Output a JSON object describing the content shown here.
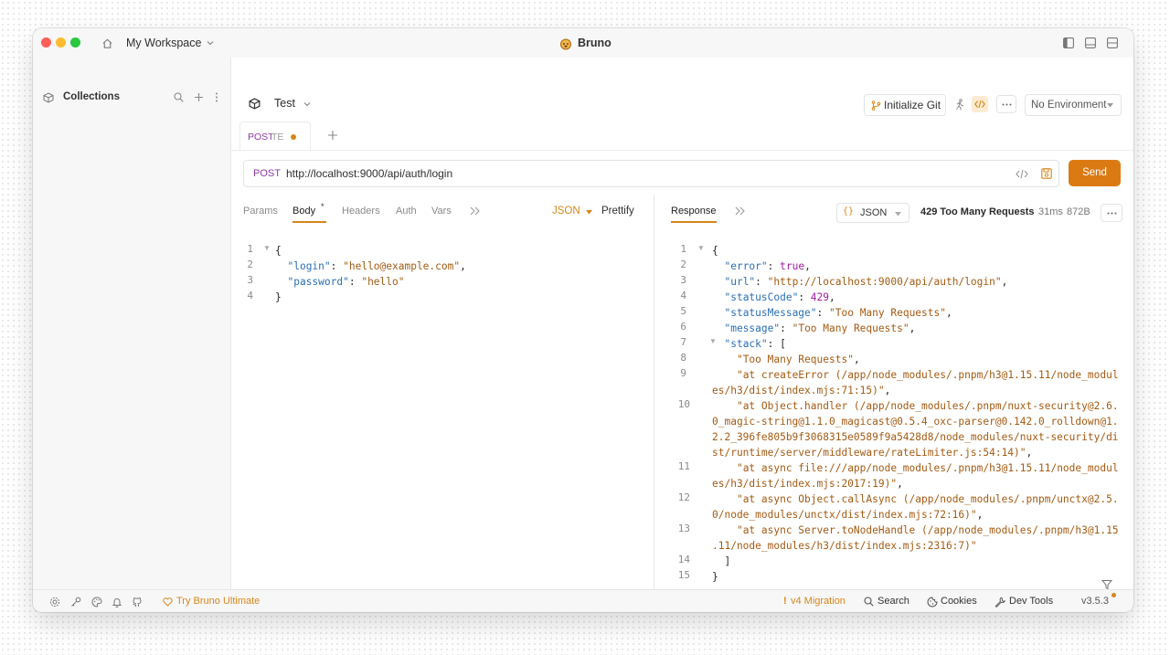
{
  "titlebar": {
    "workspace": "My Workspace",
    "app_title": "Bruno"
  },
  "sidebar": {
    "title": "Collections"
  },
  "collection": {
    "name": "Test",
    "init_git": "Initialize Git",
    "environment": "No Environment"
  },
  "tab": {
    "method": "POST",
    "name": "TE"
  },
  "request": {
    "method": "POST",
    "url": "http://localhost:9000/api/auth/login",
    "send_label": "Send",
    "tabs": [
      "Params",
      "Body",
      "Headers",
      "Auth",
      "Vars"
    ],
    "active_tab": "Body",
    "body_mode": "JSON",
    "prettify": "Prettify",
    "body_lines": [
      "{",
      "  \"login\": \"hello@example.com\",",
      "  \"password\": \"hello\"",
      "}"
    ]
  },
  "response": {
    "tab_label": "Response",
    "format": "JSON",
    "status": "429 Too Many Requests",
    "time": "31ms",
    "size": "872B"
  },
  "statusbar": {
    "try_ultimate": "Try Bruno Ultimate",
    "migration": "v4 Migration",
    "search": "Search",
    "cookies": "Cookies",
    "dev_tools": "Dev Tools",
    "version": "v3.5.3"
  },
  "colors": {
    "accent": "#d6861a",
    "send_bg": "#db7a13",
    "post_method": "#8e3aa4",
    "json_key": "#2c6fb3",
    "json_string": "#a35b13",
    "json_value": "#a01ba3"
  }
}
